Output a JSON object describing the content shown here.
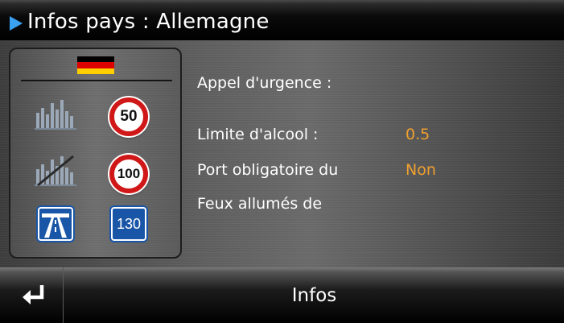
{
  "header": {
    "title": "Infos pays : Allemagne",
    "arrow_color": "#3aa0f0"
  },
  "panel": {
    "flag_colors": [
      "#000000",
      "#dd0000",
      "#ffce00"
    ],
    "city_speed": "50",
    "outside_city_speed": "100",
    "motorway_speed": "130",
    "icons": [
      "city-icon",
      "end-of-city-icon",
      "motorway-icon"
    ]
  },
  "info": {
    "emergency_label": "Appel d'urgence :",
    "alcohol_label": "Limite d'alcool :",
    "alcohol_value": "0.5",
    "vest_label": "Port obligatoire du",
    "vest_value": "Non",
    "lights_label": "Feux allumés de"
  },
  "footer": {
    "label": "Infos",
    "back_icon": "return-arrow-icon"
  },
  "colors": {
    "value_orange": "#f0a030",
    "speed_sign_red": "#d01818",
    "motorway_blue": "#1a56a8"
  }
}
